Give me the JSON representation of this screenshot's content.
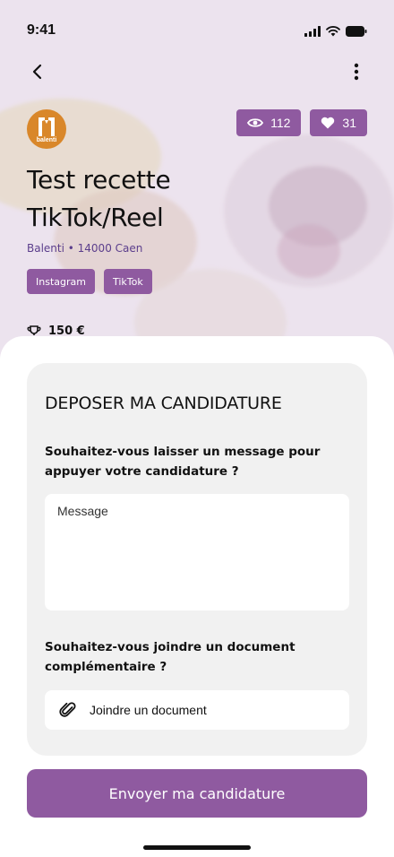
{
  "status_bar": {
    "time": "9:41"
  },
  "brand": {
    "logo_text": "balenti"
  },
  "stats": {
    "views": "112",
    "likes": "31"
  },
  "campaign": {
    "title": "Test recette TikTok/Reel",
    "brand_location": "Balenti • 14000 Caen",
    "tags": [
      "Instagram",
      "TikTok"
    ],
    "reward": "150 €"
  },
  "application": {
    "heading": "DEPOSER MA CANDIDATURE",
    "message_question": "Souhaitez-vous laisser un message pour appuyer votre candidature ?",
    "message_placeholder": "Message",
    "document_question": "Souhaitez-vous joindre un document complémentaire ?",
    "attach_label": "Joindre un document",
    "submit_label": "Envoyer ma candidature"
  },
  "colors": {
    "accent": "#8f5aa0",
    "brand_text": "#5b3e8c",
    "card_bg": "#f1f1f1"
  }
}
